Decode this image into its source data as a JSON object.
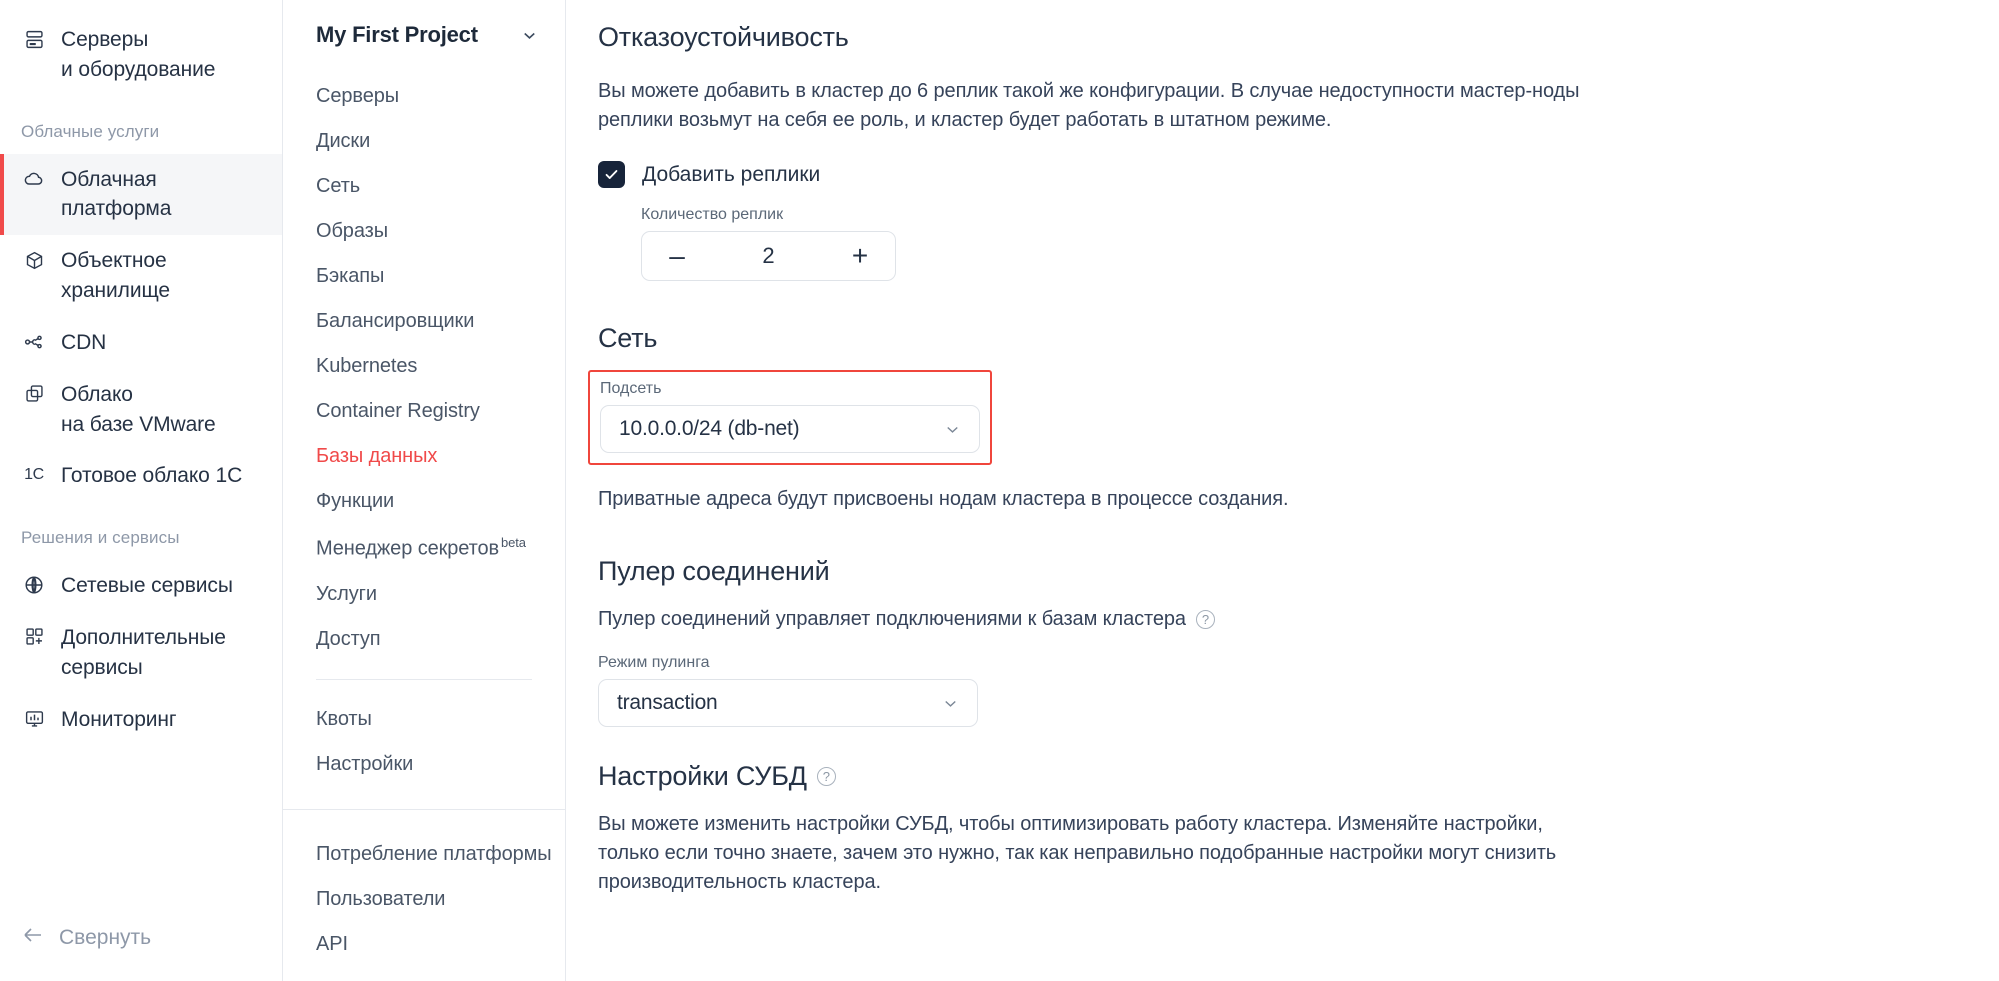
{
  "sidebar_left": {
    "items": [
      {
        "label": "Серверы\nи оборудование",
        "icon": "server-icon",
        "active": false
      },
      {
        "label": "Облачная\nплатформа",
        "icon": "cloud-icon",
        "active": true
      },
      {
        "label": "Объектное\nхранилище",
        "icon": "cube-icon",
        "active": false
      },
      {
        "label": "CDN",
        "icon": "cdn-icon",
        "active": false
      },
      {
        "label": "Облако\nна базе VMware",
        "icon": "copy-icon",
        "active": false
      },
      {
        "label": "Готовое облако 1С",
        "icon": "1c-icon",
        "active": false
      },
      {
        "label": "Сетевые сервисы",
        "icon": "globe-icon",
        "active": false
      },
      {
        "label": "Дополнительные\nсервисы",
        "icon": "grid-plus-icon",
        "active": false
      },
      {
        "label": "Мониторинг",
        "icon": "monitor-icon",
        "active": false
      }
    ],
    "group_cloud": "Облачные услуги",
    "group_solutions": "Решения и сервисы",
    "collapse_label": "Свернуть",
    "accent_color": "#f04a4a"
  },
  "sidebar_project": {
    "title": "My First Project",
    "items_main": [
      "Серверы",
      "Диски",
      "Сеть",
      "Образы",
      "Бэкапы",
      "Балансировщики",
      "Kubernetes",
      "Container Registry",
      "Базы данных",
      "Функции",
      "Менеджер секретов",
      "Услуги",
      "Доступ"
    ],
    "current_item": "Базы данных",
    "beta_badge": "beta",
    "items_settings": [
      "Квоты",
      "Настройки"
    ],
    "items_bottom": [
      "Потребление платформы",
      "Пользователи",
      "API"
    ],
    "current_color": "#f04a4a"
  },
  "main": {
    "fault_tolerance": {
      "title": "Отказоустойчивость",
      "description": "Вы можете добавить в кластер до 6 реплик такой же конфигурации. В случае недоступности мастер-ноды реплики возьмут на себя ее роль, и кластер будет работать в штатном режиме.",
      "checkbox_label": "Добавить реплики",
      "checkbox_checked": "✓",
      "replicas_label": "Количество реплик",
      "replicas_value": "2",
      "decrement": "–",
      "increment": "+"
    },
    "network": {
      "title": "Сеть",
      "subnet_label": "Подсеть",
      "subnet_value": "10.0.0.0/24 (db-net)",
      "note": "Приватные адреса будут присвоены нодам кластера в процессе создания.",
      "highlight_color": "#f0463c"
    },
    "pool": {
      "title": "Пулер соединений",
      "description": "Пулер соединений управляет подключениями к базам кластера",
      "help_glyph": "?",
      "mode_label": "Режим пулинга",
      "mode_value": "transaction"
    },
    "dbms": {
      "title": "Настройки СУБД",
      "help_glyph": "?",
      "description": "Вы можете изменить настройки СУБД, чтобы оптимизировать работу кластера. Изменяйте настройки, только если точно знаете, зачем это нужно, так как неправильно подобранные настройки могут снизить производительность кластера."
    }
  }
}
